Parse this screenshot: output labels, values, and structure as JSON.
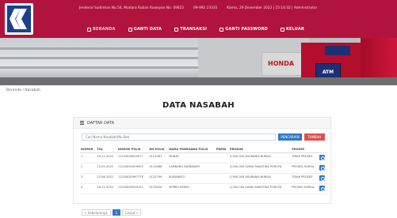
{
  "header": {
    "info": {
      "address": "Jenderal Sudirman No.54, Mutiara Ruban Ruwayan No. 09823",
      "phone": "09-992 23335",
      "datetime": "Kamis, 29 Desember 2022 | 15:14:32 | Administrator"
    },
    "nav": [
      {
        "label": "BERANDA",
        "icon": "home-icon"
      },
      {
        "label": "GANTI DATA",
        "icon": "user-icon"
      },
      {
        "label": "TRANSAKSI",
        "icon": "money-icon"
      },
      {
        "label": "GANTI PASSWORD",
        "icon": "key-icon"
      },
      {
        "label": "KELUAR",
        "icon": "logout-icon"
      }
    ]
  },
  "banner": {
    "sign_text": "HONDA",
    "atm_text": "ATM"
  },
  "breadcrumb": "Beranda / Nasabah",
  "page_title": "DATA NASABAH",
  "panel": {
    "title": "DAFTAR DATA",
    "search_placeholder": "Cari Nama Nasabah/No.Rek",
    "search_button": "PENCARIAN",
    "add_button": "TAMBAH",
    "columns": [
      "NOMOR",
      "TGL",
      "NOMOR POLIS",
      "NO.POLIS",
      "NAMA PEMEGANG POLIS",
      "PREMI",
      "PRODUK",
      "PROSES"
    ],
    "rows": [
      [
        "1",
        "29-11-2022",
        "1122083092057I",
        "0121081",
        "MUNAT",
        "",
        "3,500,000 ASURANSI BUNGA",
        "TIDAK PROSES"
      ],
      [
        "2",
        "12-05-2022",
        "1122083190990F",
        "0113488",
        "LAMBANG INDRAWATI",
        "",
        "3,000,000 GAMA SWASTIKA PORUTA",
        "PROSES HARGA"
      ],
      [
        "3",
        "12-06-2022",
        "1122083196777E",
        "0122799",
        "KUSWANTO",
        "",
        "2,900,000 ASURANSI BUNGA",
        "TIDAK PROSES"
      ],
      [
        "4",
        "16-11-2022",
        "11220832099121",
        "0133424",
        "SEPRIS ARDYO",
        "",
        "4,000,000 GAMA SWASTIKA PORUTA",
        "PROSES HARGA"
      ]
    ],
    "pager": {
      "prev": "« Sebelumnya",
      "current": "1",
      "next": "Lanjut »"
    }
  },
  "colors": {
    "header": "#b0143c",
    "primary_button": "#2f79c6",
    "danger_button": "#d9534f"
  }
}
